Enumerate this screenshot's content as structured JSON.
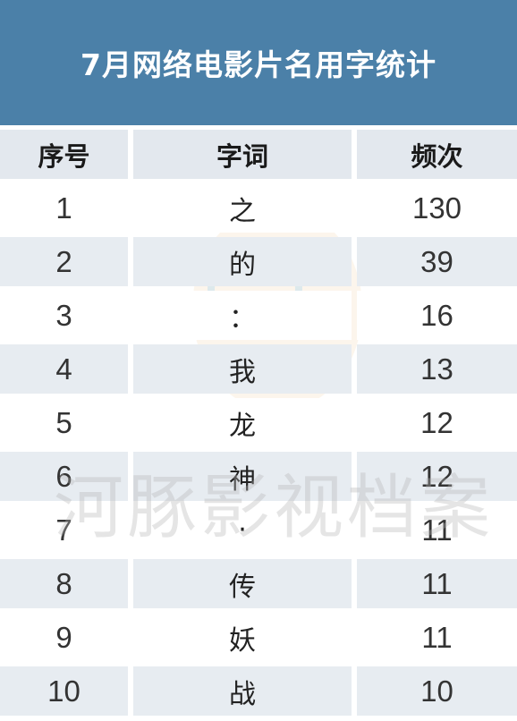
{
  "title": "7月网络电影片名用字统计",
  "watermark": "河豚影视档案",
  "colors": {
    "title_bg": "#4b80a8",
    "header_bg": "#e3e8ee",
    "alt_row_bg": "#e7ecf1"
  },
  "chart_data": {
    "type": "table",
    "title": "7月网络电影片名用字统计",
    "columns": [
      "序号",
      "字词",
      "频次"
    ],
    "rows": [
      [
        "1",
        "之",
        "130"
      ],
      [
        "2",
        "的",
        "39"
      ],
      [
        "3",
        "：",
        "16"
      ],
      [
        "4",
        "我",
        "13"
      ],
      [
        "5",
        "龙",
        "12"
      ],
      [
        "6",
        "神",
        "12"
      ],
      [
        "7",
        "·",
        "11"
      ],
      [
        "8",
        "传",
        "11"
      ],
      [
        "9",
        "妖",
        "11"
      ],
      [
        "10",
        "战",
        "10"
      ]
    ]
  }
}
